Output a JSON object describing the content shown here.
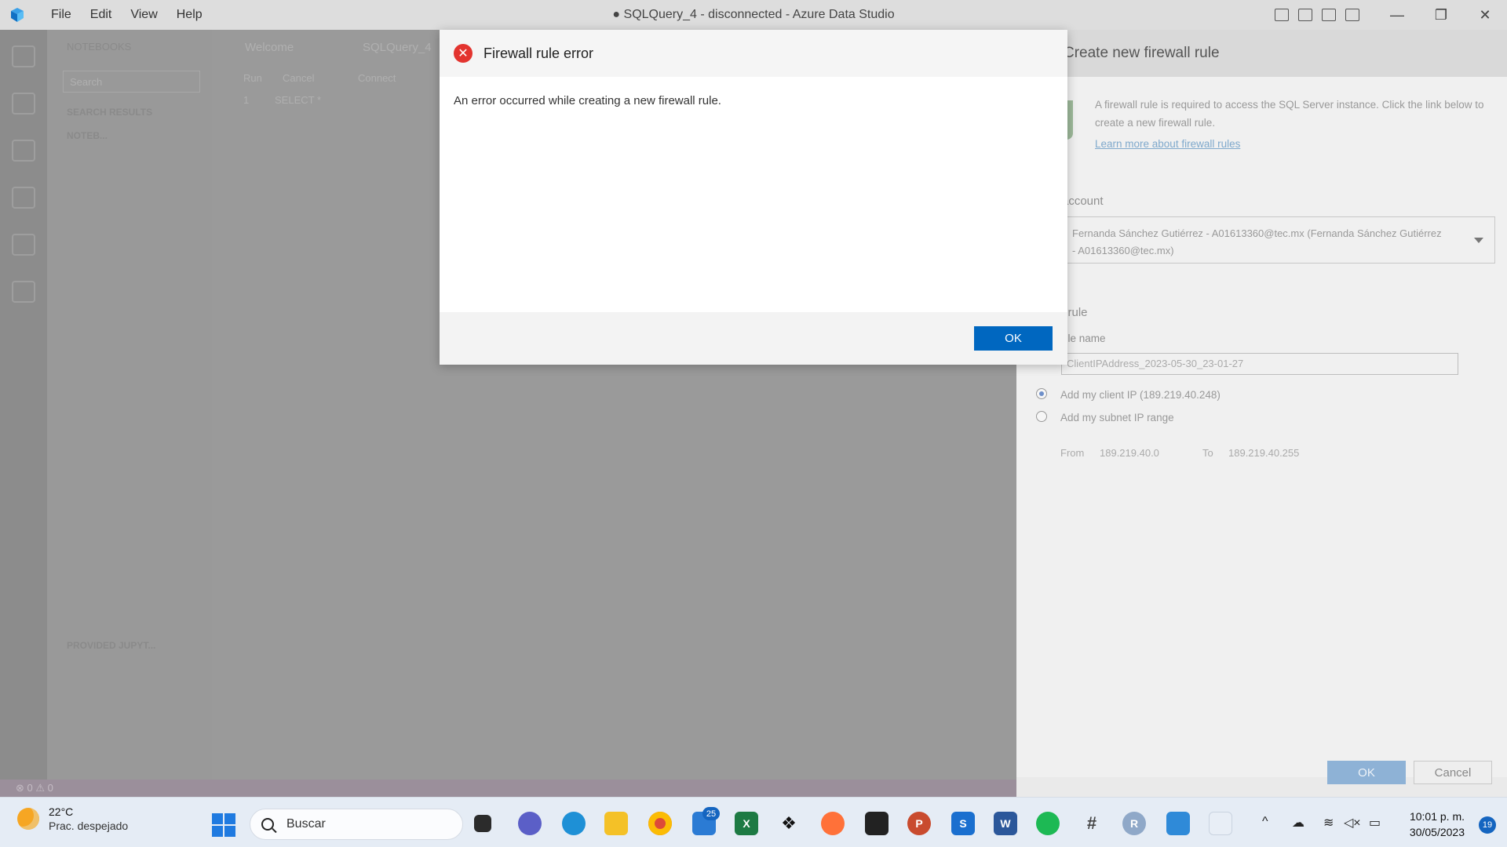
{
  "window": {
    "title": "● SQLQuery_4 - disconnected - Azure Data Studio",
    "menu": [
      "File",
      "Edit",
      "View",
      "Help"
    ],
    "controls": [
      "—",
      "❐",
      "✕"
    ]
  },
  "background": {
    "sidebar_title": "NOTEBOOKS",
    "search_placeholder": "Search",
    "search_results": "SEARCH RESULTS",
    "notebooks_section": "NOTEB...",
    "provided_section": "PROVIDED JUPYT...",
    "tabs": [
      "Welcome",
      "SQLQuery_4"
    ],
    "toolbar": [
      "Run",
      "Cancel",
      "Connect"
    ],
    "editor_line_number": "1",
    "editor_line_text": "SELECT *",
    "status": "⊗ 0 ⚠ 0"
  },
  "firewall_pane": {
    "title": "Create new firewall rule",
    "description": "A firewall rule is required to access the SQL Server instance. Click the link below to create a new firewall rule.",
    "link": "Learn more about firewall rules",
    "account_label": "account",
    "account_value": "Fernanda Sánchez Gutiérrez - A01613360@tec.mx (Fernanda Sánchez Gutiérrez - A01613360@tec.mx)",
    "rule_section": "l rule",
    "rule_name_label": "ule name",
    "rule_name_value": "ClientIPAddress_2023-05-30_23-01-27",
    "radio_client": "Add my client IP (189.219.40.248)",
    "radio_subnet": "Add my subnet IP range",
    "from_label": "From",
    "from_value": "189.219.40.0",
    "to_label": "To",
    "to_value": "189.219.40.255",
    "ok_label": "OK",
    "cancel_label": "Cancel"
  },
  "dialog": {
    "title": "Firewall rule error",
    "message": "An error occurred while creating a new firewall rule.",
    "ok_label": "OK",
    "icon": "error-icon",
    "accent": "#0067c0"
  },
  "taskbar": {
    "temperature": "22°C",
    "weather": "Prac. despejado",
    "search_placeholder": "Buscar",
    "mail_badge": "25",
    "time": "10:01 p. m.",
    "date": "30/05/2023",
    "notification_count": "19"
  }
}
